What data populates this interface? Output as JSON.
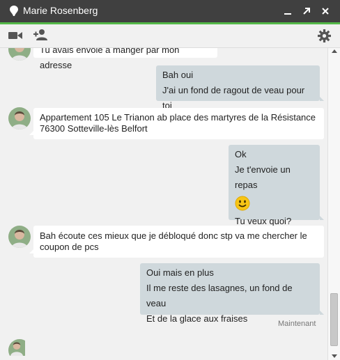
{
  "window": {
    "title": "Marie Rosenberg",
    "presence_icon": "presence-dot-icon",
    "controls": [
      "minimize-icon",
      "popout-icon",
      "close-icon"
    ]
  },
  "toolbar": {
    "icons": [
      "video-call-icon",
      "add-person-icon",
      "settings-gear-icon"
    ]
  },
  "conversation": {
    "messages": [
      {
        "direction": "in",
        "lines": [
          "Tu avais envoie à manger par mon adresse"
        ]
      },
      {
        "direction": "out",
        "lines": [
          "Bah oui",
          "J'ai un fond de ragout de veau pour toi"
        ]
      },
      {
        "direction": "in",
        "lines": [
          "Appartement 105 Le Trianon ab place des martyres de la Résistance",
          "76300 Sotteville-lès Belfort"
        ]
      },
      {
        "direction": "out",
        "lines": [
          "Ok",
          "Je t'envoie un repas",
          "🙂",
          "Tu veux quoi?"
        ]
      },
      {
        "direction": "in",
        "lines": [
          "Bah écoute ces mieux que je débloqué donc stp va me chercher le",
          "coupon de pcs"
        ]
      },
      {
        "direction": "out",
        "lines": [
          "Oui mais en plus",
          "Il me reste des lasagnes, un fond de veau",
          "Et de la glace aux fraises"
        ]
      }
    ],
    "timestamp": "Maintenant"
  },
  "colors": {
    "titlebar": "#404040",
    "accent": "#54b848",
    "outgoing_bubble": "#cfd8dc",
    "incoming_bubble": "#ffffff",
    "background": "#f1f1f1"
  }
}
